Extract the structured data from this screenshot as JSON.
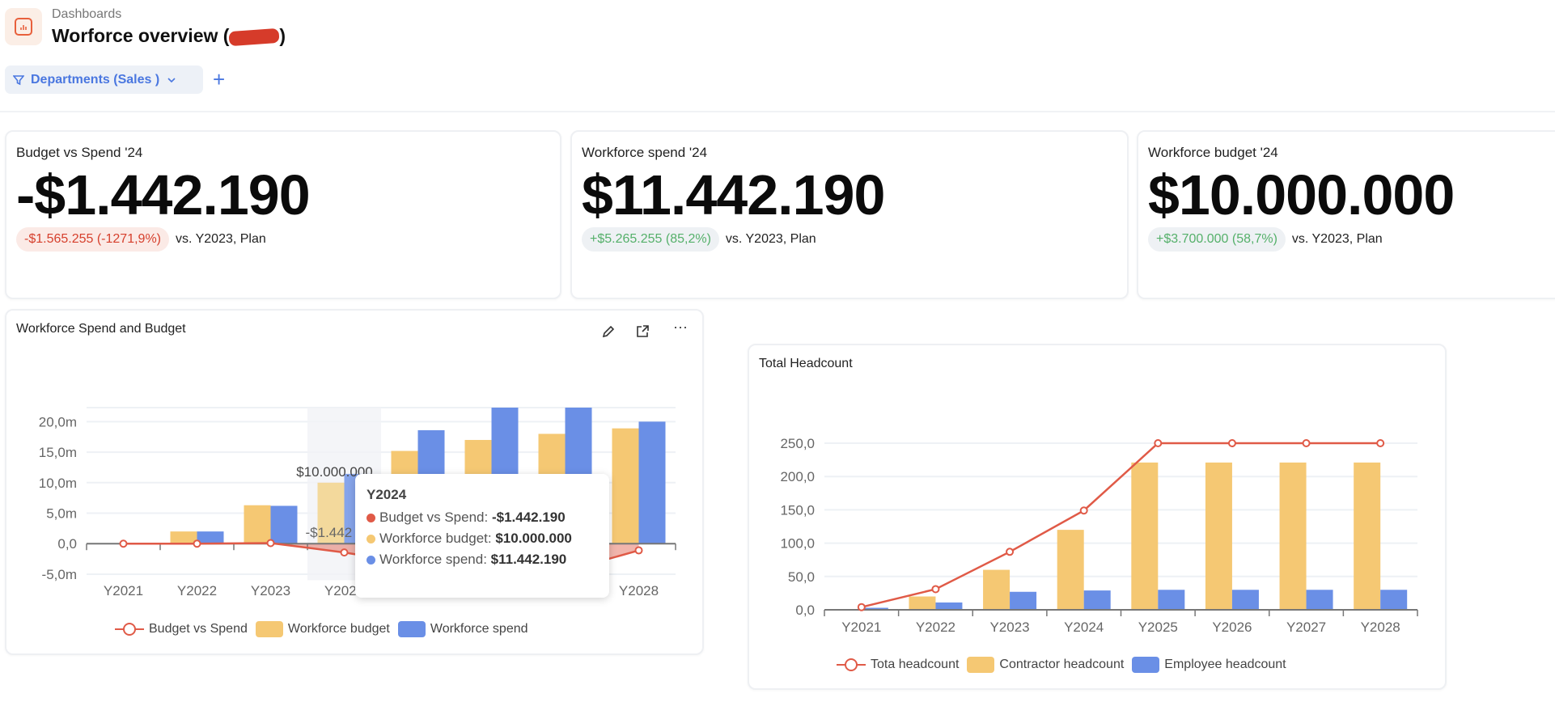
{
  "header": {
    "breadcrumb": "Dashboards",
    "title": "Worforce overview (",
    "title_end": ")",
    "icon": "bar-chart-icon"
  },
  "filter": {
    "label": "Departments (Sales )",
    "add_label": "+"
  },
  "kpis": [
    {
      "label": "Budget vs Spend '24",
      "value": "-$1.442.190",
      "delta": "-$1.565.255 (-1271,9%)",
      "delta_sign": "negative",
      "comparison": "vs. Y2023, Plan"
    },
    {
      "label": "Workforce spend '24",
      "value": "$11.442.190",
      "delta": "+$5.265.255 (85,2%)",
      "delta_sign": "positive",
      "comparison": "vs. Y2023, Plan"
    },
    {
      "label": "Workforce budget '24",
      "value": "$10.000.000",
      "delta": "+$3.700.000 (58,7%)",
      "delta_sign": "positive",
      "comparison": "vs. Y2023, Plan"
    }
  ],
  "colors": {
    "line": "#e05a47",
    "budget": "#f5c873",
    "spend": "#6a8fe6",
    "negative": "#d6402d",
    "positive": "#55b06a",
    "accent": "#4a77e0"
  },
  "chart_data": [
    {
      "type": "bar",
      "title": "Workforce Spend and Budget",
      "categories": [
        "Y2021",
        "Y2022",
        "Y2023",
        "Y2024",
        "Y2025",
        "Y2026",
        "Y2027",
        "Y2028"
      ],
      "ylim": [
        -6,
        22.3
      ],
      "yticks": [
        -5,
        0,
        5,
        10,
        15,
        20
      ],
      "ytick_labels": [
        "-5,0m",
        "0,0",
        "5,0m",
        "10,0m",
        "15,0m",
        "20,0m"
      ],
      "grid": true,
      "legend": "bottom",
      "series": [
        {
          "name": "Budget vs Spend",
          "kind": "line",
          "values": [
            0,
            0,
            0.1,
            -1.44,
            -3.4,
            -5.5,
            -4.5,
            -1.1
          ]
        },
        {
          "name": "Workforce budget",
          "kind": "bar",
          "values": [
            0,
            2.0,
            6.3,
            10.0,
            15.2,
            17.0,
            18.0,
            18.9
          ]
        },
        {
          "name": "Workforce spend",
          "kind": "bar",
          "values": [
            0,
            2.0,
            6.2,
            11.44,
            18.6,
            22.3,
            22.3,
            20.0
          ]
        }
      ],
      "highlight": "Y2024",
      "data_labels": {
        "budget": "$10.000.000",
        "line": "-$1.442"
      },
      "tooltip": {
        "title": "Y2024",
        "rows": [
          {
            "label": "Budget vs Spend:",
            "value": "-$1.442.190"
          },
          {
            "label": "Workforce budget:",
            "value": "$10.000.000"
          },
          {
            "label": "Workforce spend:",
            "value": "$11.442.190"
          }
        ]
      },
      "toolbar": {
        "edit": "pencil-icon",
        "open": "external-link-icon",
        "more": "···"
      }
    },
    {
      "type": "bar",
      "title": "Total Headcount",
      "categories": [
        "Y2021",
        "Y2022",
        "Y2023",
        "Y2024",
        "Y2025",
        "Y2026",
        "Y2027",
        "Y2028"
      ],
      "ylim": [
        0,
        250
      ],
      "yticks": [
        0,
        50,
        100,
        150,
        200,
        250
      ],
      "ytick_labels": [
        "0,0",
        "50,0",
        "100,0",
        "150,0",
        "200,0",
        "250,0"
      ],
      "grid": true,
      "legend": "bottom",
      "series": [
        {
          "name": "Tota headcount",
          "kind": "line",
          "values": [
            4,
            31,
            87,
            149,
            250,
            250,
            250,
            250
          ]
        },
        {
          "name": "Contractor headcount",
          "kind": "bar",
          "values": [
            0,
            20,
            60,
            120,
            221,
            221,
            221,
            221
          ]
        },
        {
          "name": "Employee headcount",
          "kind": "bar",
          "values": [
            3,
            11,
            27,
            29,
            30,
            30,
            30,
            30
          ]
        }
      ]
    }
  ]
}
